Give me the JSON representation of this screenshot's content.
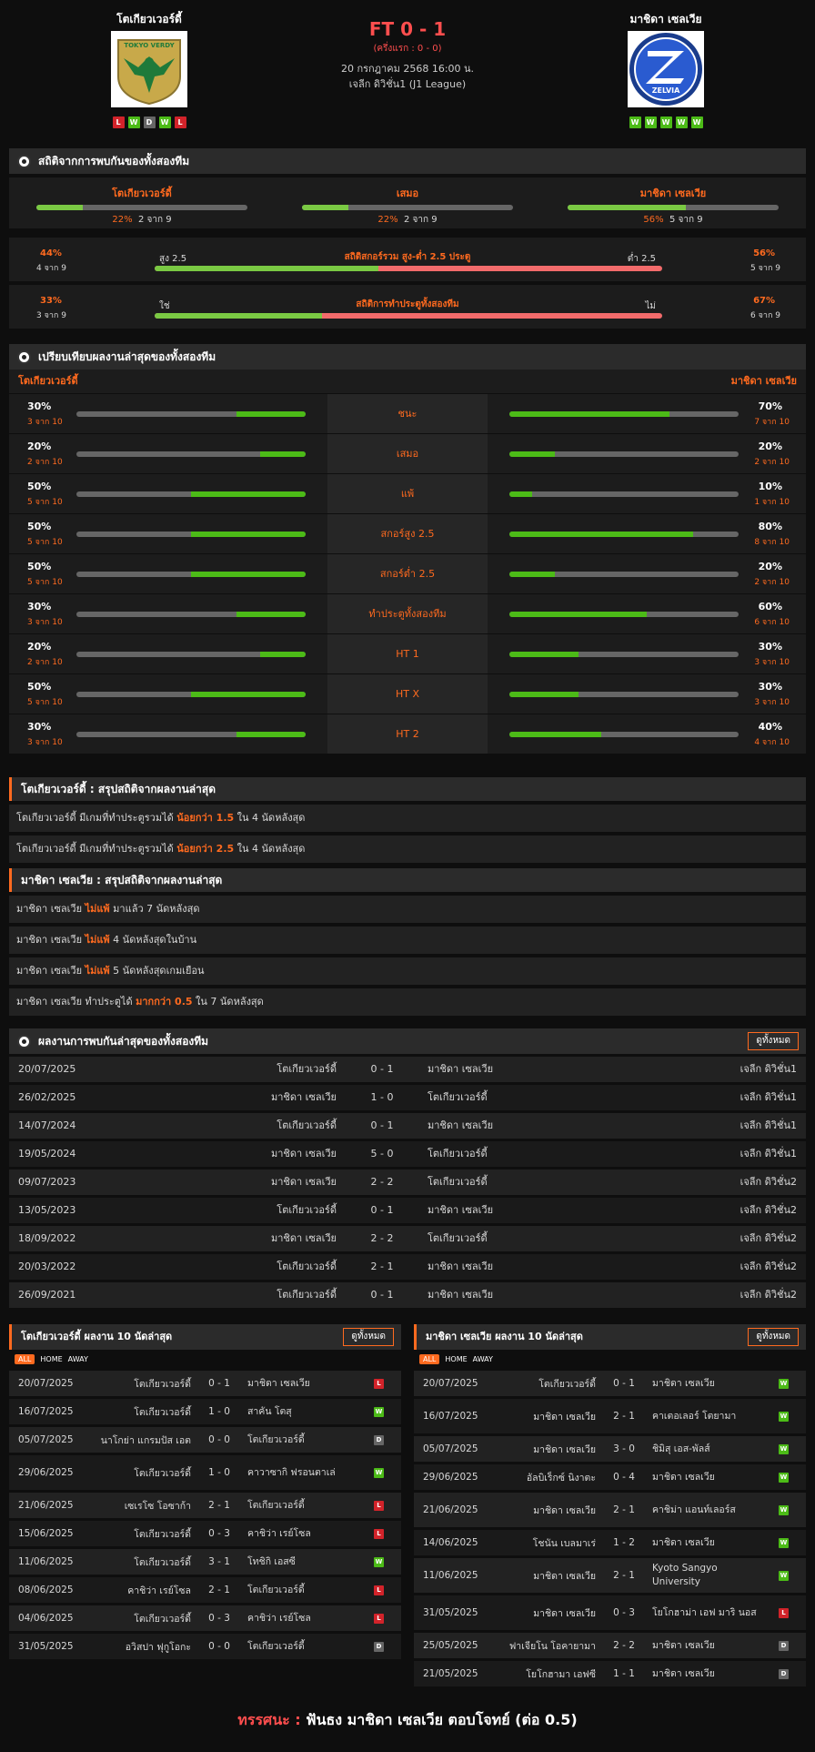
{
  "match": {
    "home_name": "โตเกียวเวอร์ดี้",
    "away_name": "มาชิดา เซลเวีย",
    "score": "FT 0 - 1",
    "halftime": "(ครึ่งแรก : 0 - 0)",
    "datetime": "20 กรกฎาคม 2568 16:00 น.",
    "league": "เจลีก ดิวิชั่น1 (J1 League)",
    "home_logo_text": "TOKYO VERDY",
    "away_logo_text": "ZELVIA",
    "home_form": [
      "L",
      "W",
      "D",
      "W",
      "L"
    ],
    "away_form": [
      "W",
      "W",
      "W",
      "W",
      "W"
    ]
  },
  "h2h": {
    "title": "สถิติจากการพบกันของทั้งสองทีม",
    "cols": [
      {
        "label": "โตเกียวเวอร์ดี้",
        "pct": "22%",
        "count": "2 จาก 9",
        "value": 22
      },
      {
        "label": "เสมอ",
        "pct": "22%",
        "count": "2 จาก 9",
        "value": 22
      },
      {
        "label": "มาชิดา เซลเวีย",
        "pct": "56%",
        "count": "5 จาก 9",
        "value": 56
      }
    ],
    "uo": {
      "title": "สถิติสกอร์รวม สูง-ต่ำ 2.5 ประตู",
      "left_pct": "44%",
      "left_count": "4 จาก 9",
      "right_pct": "56%",
      "right_count": "5 จาก 9",
      "left_label": "สูง 2.5",
      "right_label": "ต่ำ 2.5",
      "value": 44
    },
    "btts": {
      "title": "สถิติการทำประตูทั้งสองทีม",
      "left_pct": "33%",
      "left_count": "3 จาก 9",
      "right_pct": "67%",
      "right_count": "6 จาก 9",
      "left_label": "ใช่",
      "right_label": "ไม่",
      "value": 33
    }
  },
  "compare": {
    "title": "เปรียบเทียบผลงานล่าสุดของทั้งสองทีม",
    "home": "โตเกียวเวอร์ดี้",
    "away": "มาชิดา เซลเวีย",
    "rows": [
      {
        "label": "ชนะ",
        "hp": "30%",
        "hn": "3 จาก 10",
        "hv": 30,
        "ap": "70%",
        "an": "7 จาก 10",
        "av": 70
      },
      {
        "label": "เสมอ",
        "hp": "20%",
        "hn": "2 จาก 10",
        "hv": 20,
        "ap": "20%",
        "an": "2 จาก 10",
        "av": 20
      },
      {
        "label": "แพ้",
        "hp": "50%",
        "hn": "5 จาก 10",
        "hv": 50,
        "ap": "10%",
        "an": "1 จาก 10",
        "av": 10
      },
      {
        "label": "สกอร์สูง 2.5",
        "hp": "50%",
        "hn": "5 จาก 10",
        "hv": 50,
        "ap": "80%",
        "an": "8 จาก 10",
        "av": 80
      },
      {
        "label": "สกอร์ต่ำ 2.5",
        "hp": "50%",
        "hn": "5 จาก 10",
        "hv": 50,
        "ap": "20%",
        "an": "2 จาก 10",
        "av": 20
      },
      {
        "label": "ทำประตูทั้งสองทีม",
        "hp": "30%",
        "hn": "3 จาก 10",
        "hv": 30,
        "ap": "60%",
        "an": "6 จาก 10",
        "av": 60
      },
      {
        "label": "HT 1",
        "hp": "20%",
        "hn": "2 จาก 10",
        "hv": 20,
        "ap": "30%",
        "an": "3 จาก 10",
        "av": 30
      },
      {
        "label": "HT X",
        "hp": "50%",
        "hn": "5 จาก 10",
        "hv": 50,
        "ap": "30%",
        "an": "3 จาก 10",
        "av": 30
      },
      {
        "label": "HT 2",
        "hp": "30%",
        "hn": "3 จาก 10",
        "hv": 30,
        "ap": "40%",
        "an": "4 จาก 10",
        "av": 40
      }
    ]
  },
  "home_summary": {
    "title": "โตเกียวเวอร์ดี้ : สรุปสถิติจากผลงานล่าสุด",
    "rows": [
      {
        "a": "โตเกียวเวอร์ดี้ มีเกมที่ทำประตูรวมได้ ",
        "b": "น้อยกว่า 1.5",
        "c": " ใน 4 นัดหลังสุด"
      },
      {
        "a": "โตเกียวเวอร์ดี้ มีเกมที่ทำประตูรวมได้ ",
        "b": "น้อยกว่า 2.5",
        "c": " ใน 4 นัดหลังสุด"
      }
    ]
  },
  "away_summary": {
    "title": "มาชิดา เซลเวีย : สรุปสถิติจากผลงานล่าสุด",
    "rows": [
      {
        "a": "มาชิดา เซลเวีย ",
        "b": "ไม่แพ้",
        "c": " มาแล้ว 7 นัดหลังสุด"
      },
      {
        "a": "มาชิดา เซลเวีย ",
        "b": "ไม่แพ้",
        "c": " 4 นัดหลังสุดในบ้าน"
      },
      {
        "a": "มาชิดา เซลเวีย ",
        "b": "ไม่แพ้",
        "c": " 5 นัดหลังสุดเกมเยือน"
      },
      {
        "a": "มาชิดา เซลเวีย ทำประตูได้ ",
        "b": "มากกว่า 0.5",
        "c": " ใน 7 นัดหลังสุด"
      }
    ]
  },
  "h2h_results": {
    "title": "ผลงานการพบกันล่าสุดของทั้งสองทีม",
    "view_all": "ดูทั้งหมด",
    "rows": [
      [
        "20/07/2025",
        "โตเกียวเวอร์ดี้",
        "0 - 1",
        "มาชิดา เซลเวีย",
        "เจลีก ดิวิชั่น1"
      ],
      [
        "26/02/2025",
        "มาชิดา เซลเวีย",
        "1 - 0",
        "โตเกียวเวอร์ดี้",
        "เจลีก ดิวิชั่น1"
      ],
      [
        "14/07/2024",
        "โตเกียวเวอร์ดี้",
        "0 - 1",
        "มาชิดา เซลเวีย",
        "เจลีก ดิวิชั่น1"
      ],
      [
        "19/05/2024",
        "มาชิดา เซลเวีย",
        "5 - 0",
        "โตเกียวเวอร์ดี้",
        "เจลีก ดิวิชั่น1"
      ],
      [
        "09/07/2023",
        "มาชิดา เซลเวีย",
        "2 - 2",
        "โตเกียวเวอร์ดี้",
        "เจลีก ดิวิชั่น2"
      ],
      [
        "13/05/2023",
        "โตเกียวเวอร์ดี้",
        "0 - 1",
        "มาชิดา เซลเวีย",
        "เจลีก ดิวิชั่น2"
      ],
      [
        "18/09/2022",
        "มาชิดา เซลเวีย",
        "2 - 2",
        "โตเกียวเวอร์ดี้",
        "เจลีก ดิวิชั่น2"
      ],
      [
        "20/03/2022",
        "โตเกียวเวอร์ดี้",
        "2 - 1",
        "มาชิดา เซลเวีย",
        "เจลีก ดิวิชั่น2"
      ],
      [
        "26/09/2021",
        "โตเกียวเวอร์ดี้",
        "0 - 1",
        "มาชิดา เซลเวีย",
        "เจลีก ดิวิชั่น2"
      ]
    ]
  },
  "home_last": {
    "title": "โตเกียวเวอร์ดี้ ผลงาน 10 นัดล่าสุด",
    "view_all": "ดูทั้งหมด",
    "filters": [
      "ALL",
      "HOME",
      "AWAY"
    ],
    "rows": [
      [
        "20/07/2025",
        "โตเกียวเวอร์ดี้",
        "0 - 1",
        "มาชิดา เซลเวีย",
        "L"
      ],
      [
        "16/07/2025",
        "โตเกียวเวอร์ดี้",
        "1 - 0",
        "สาคัน โตสุ",
        "W"
      ],
      [
        "05/07/2025",
        "นาโกย่า แกรมปัส เอต",
        "0 - 0",
        "โตเกียวเวอร์ดี้",
        "D"
      ],
      [
        "29/06/2025",
        "โตเกียวเวอร์ดี้",
        "1 - 0",
        "คาวาซากิ ฟรอนตาเล่",
        "W"
      ],
      [
        "21/06/2025",
        "เซเรโซ โอซาก้า",
        "2 - 1",
        "โตเกียวเวอร์ดี้",
        "L"
      ],
      [
        "15/06/2025",
        "โตเกียวเวอร์ดี้",
        "0 - 3",
        "คาชิว่า เรย์โซล",
        "L"
      ],
      [
        "11/06/2025",
        "โตเกียวเวอร์ดี้",
        "3 - 1",
        "โทชิกิ เอสซี",
        "W"
      ],
      [
        "08/06/2025",
        "คาชิว่า เรย์โซล",
        "2 - 1",
        "โตเกียวเวอร์ดี้",
        "L"
      ],
      [
        "04/06/2025",
        "โตเกียวเวอร์ดี้",
        "0 - 3",
        "คาชิว่า เรย์โซล",
        "L"
      ],
      [
        "31/05/2025",
        "อวิสปา ฟุกูโอกะ",
        "0 - 0",
        "โตเกียวเวอร์ดี้",
        "D"
      ]
    ]
  },
  "away_last": {
    "title": "มาชิดา เซลเวีย ผลงาน 10 นัดล่าสุด",
    "view_all": "ดูทั้งหมด",
    "filters": [
      "ALL",
      "HOME",
      "AWAY"
    ],
    "rows": [
      [
        "20/07/2025",
        "โตเกียวเวอร์ดี้",
        "0 - 1",
        "มาชิดา เซลเวีย",
        "W"
      ],
      [
        "16/07/2025",
        "มาชิดา เซลเวีย",
        "2 - 1",
        "คาเตอเลอร์ โตยามา",
        "W"
      ],
      [
        "05/07/2025",
        "มาชิดา เซลเวีย",
        "3 - 0",
        "ชิมิสุ เอส-พัลส์",
        "W"
      ],
      [
        "29/06/2025",
        "อัลบิเร็กซ์ นิงาตะ",
        "0 - 4",
        "มาชิดา เซลเวีย",
        "W"
      ],
      [
        "21/06/2025",
        "มาชิดา เซลเวีย",
        "2 - 1",
        "คาชิม่า แอนท์เลอร์ส",
        "W"
      ],
      [
        "14/06/2025",
        "โชนัน เบลมาเร่",
        "1 - 2",
        "มาชิดา เซลเวีย",
        "W"
      ],
      [
        "11/06/2025",
        "มาชิดา เซลเวีย",
        "2 - 1",
        "Kyoto Sangyo University",
        "W"
      ],
      [
        "31/05/2025",
        "มาชิดา เซลเวีย",
        "0 - 3",
        "โยโกฮาม่า เอฟ มาริ นอส",
        "L"
      ],
      [
        "25/05/2025",
        "ฟาเจียโน โอคายามา",
        "2 - 2",
        "มาชิดา เซลเวีย",
        "D"
      ],
      [
        "21/05/2025",
        "โยโกฮามา เอฟซี",
        "1 - 1",
        "มาชิดา เซลเวีย",
        "D"
      ]
    ]
  },
  "verdict": {
    "label": "ทรรศนะ :",
    "text": "ฟันธง มาชิดา เซลเวีย ตอบโจทย์ (ต่อ 0.5)"
  }
}
